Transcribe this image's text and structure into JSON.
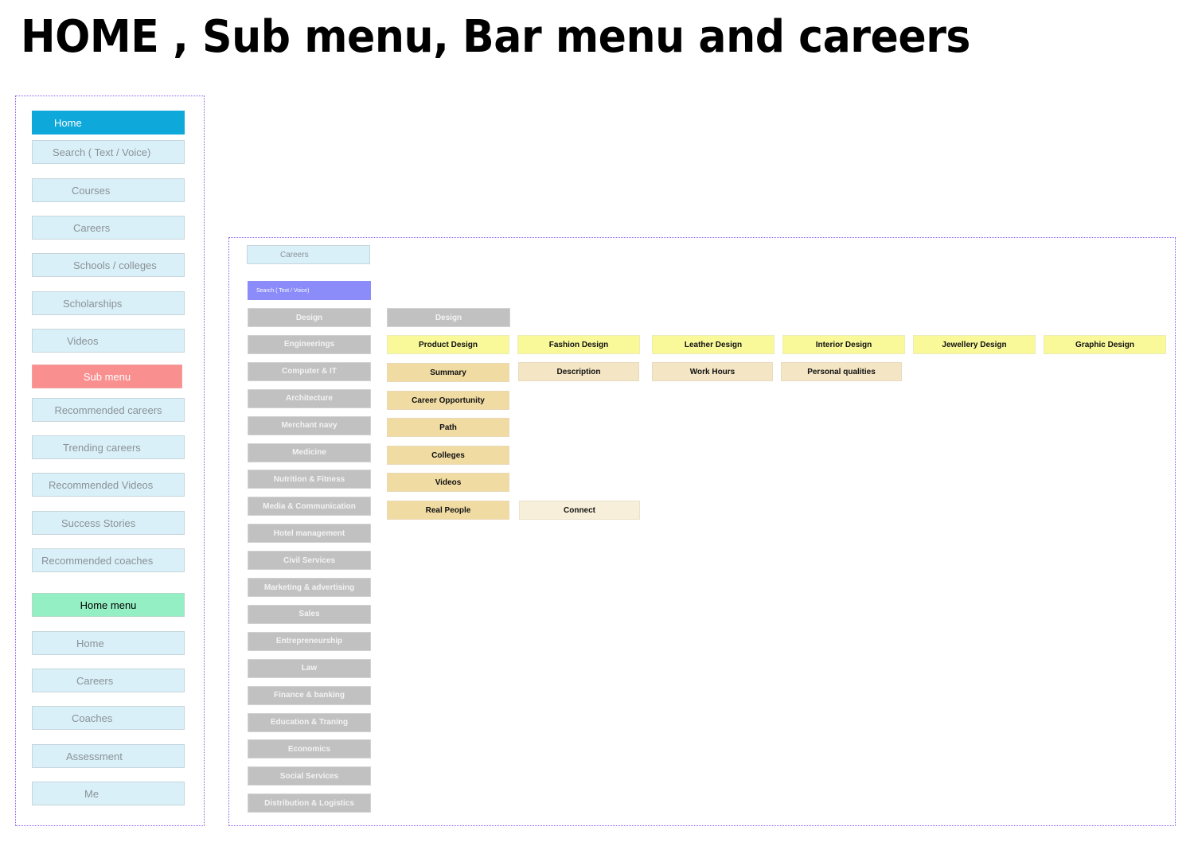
{
  "title": "HOME , Sub menu, Bar menu and careers",
  "home_panel": {
    "home_header": "Home",
    "home_items": [
      "Search ( Text / Voice)",
      "Courses",
      "Careers",
      "Schools / colleges",
      "Scholarships",
      "Videos"
    ],
    "sub_menu_header": "Sub menu",
    "sub_menu_items": [
      "Recommended careers",
      "Trending careers",
      "Recommended Videos",
      "Success Stories",
      "Recommended coaches"
    ],
    "home_menu_header": "Home menu",
    "home_menu_items": [
      "Home",
      "Careers",
      "Coaches",
      "Assessment",
      "Me"
    ]
  },
  "careers_panel": {
    "header": "Careers",
    "search": "Search ( Text / Voice)",
    "categories": [
      "Design",
      "Engineerings",
      "Computer & IT",
      "Architecture",
      "Merchant navy",
      "Medicine",
      "Nutrition & Fitness",
      "Media & Communication",
      "Hotel management",
      "Civil Services",
      "Marketing & advertising",
      "Sales",
      "Entrepreneurship",
      "Law",
      "Finance & banking",
      "Education & Traning",
      "Economics",
      "Social Services",
      "Distribution & Logistics"
    ],
    "selected_category": "Design",
    "design_types": [
      "Product Design",
      "Fashion Design",
      "Leather Design",
      "Interior  Design",
      "Jewellery  Design",
      "Graphic  Design"
    ],
    "detail_sections": [
      "Summary",
      "Career Opportunity",
      "Path",
      "Colleges",
      "Videos",
      "Real People"
    ],
    "summary_subsections": [
      "Description",
      "Work Hours",
      "Personal qualities"
    ],
    "real_people_action": "Connect"
  },
  "colors": {
    "frame_border": "#8a5cf0",
    "home_header": "#0fa8db",
    "sub_menu_header": "#f98f8e",
    "home_menu_header": "#95efc4",
    "menu_item_bg": "#daf0f8",
    "search_bg": "#8b8bfa",
    "category_bg": "#c1c1c1",
    "design_type_bg": "#f9f99a",
    "section_bg": "#f0dba3",
    "subsection_bg": "#f4e6c4",
    "connect_bg": "#f7efd9"
  }
}
